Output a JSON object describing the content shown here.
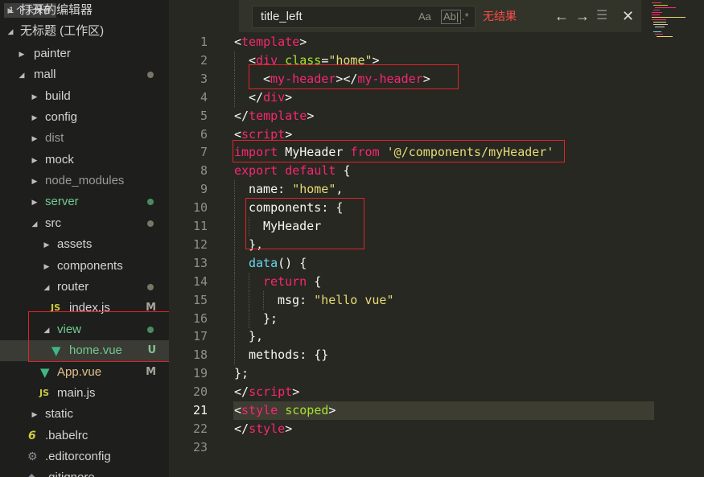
{
  "sidebar": {
    "open_editors_label": "打开的编辑器",
    "unsaved_badge": "1 个未保存",
    "workspace_label": "无标题 (工作区)",
    "items": [
      {
        "label": "painter"
      },
      {
        "label": "mall"
      },
      {
        "label": "build"
      },
      {
        "label": "config"
      },
      {
        "label": "dist"
      },
      {
        "label": "mock"
      },
      {
        "label": "node_modules"
      },
      {
        "label": "server"
      },
      {
        "label": "src"
      },
      {
        "label": "assets"
      },
      {
        "label": "components"
      },
      {
        "label": "router"
      },
      {
        "label": "index.js",
        "icon": "JS",
        "badge": "M"
      },
      {
        "label": "view"
      },
      {
        "label": "home.vue",
        "badge": "U"
      },
      {
        "label": "App.vue",
        "badge": "M"
      },
      {
        "label": "main.js",
        "icon": "JS"
      },
      {
        "label": "static"
      },
      {
        "label": ".babelrc"
      },
      {
        "label": ".editorconfig"
      },
      {
        "label": ".gitignore"
      }
    ]
  },
  "find": {
    "query": "title_left",
    "case_label": "Aa",
    "word_label": "Ab|",
    "regex_label": ".*",
    "status": "无结果",
    "prev_icon": "arrow-up-icon",
    "next_icon": "arrow-down-icon",
    "close_icon": "close-icon"
  },
  "editor": {
    "line_numbers": [
      "1",
      "2",
      "3",
      "4",
      "5",
      "6",
      "7",
      "8",
      "9",
      "10",
      "11",
      "12",
      "13",
      "14",
      "15",
      "16",
      "17",
      "18",
      "19",
      "20",
      "21",
      "22",
      "23"
    ],
    "current_line": 21,
    "lines": [
      [
        {
          "t": "<",
          "c": "p"
        },
        {
          "t": "template",
          "c": "tag"
        },
        {
          "t": ">",
          "c": "p"
        }
      ],
      [
        {
          "t": "<",
          "c": "p"
        },
        {
          "t": "div",
          "c": "tag"
        },
        {
          "t": " ",
          "c": "p"
        },
        {
          "t": "class",
          "c": "attr"
        },
        {
          "t": "=",
          "c": "p"
        },
        {
          "t": "\"home\"",
          "c": "str"
        },
        {
          "t": ">",
          "c": "p"
        }
      ],
      [
        {
          "t": "<",
          "c": "p"
        },
        {
          "t": "my-header",
          "c": "tag"
        },
        {
          "t": "></",
          "c": "p"
        },
        {
          "t": "my-header",
          "c": "tag"
        },
        {
          "t": ">",
          "c": "p"
        }
      ],
      [
        {
          "t": "</",
          "c": "p"
        },
        {
          "t": "div",
          "c": "tag"
        },
        {
          "t": ">",
          "c": "p"
        }
      ],
      [
        {
          "t": "</",
          "c": "p"
        },
        {
          "t": "template",
          "c": "tag"
        },
        {
          "t": ">",
          "c": "p"
        }
      ],
      [
        {
          "t": "<",
          "c": "p"
        },
        {
          "t": "script",
          "c": "tag"
        },
        {
          "t": ">",
          "c": "p"
        }
      ],
      [
        {
          "t": "import",
          "c": "kw"
        },
        {
          "t": " MyHeader ",
          "c": "p"
        },
        {
          "t": "from",
          "c": "kw"
        },
        {
          "t": " ",
          "c": "p"
        },
        {
          "t": "'@/components/myHeader'",
          "c": "str"
        }
      ],
      [
        {
          "t": "export",
          "c": "kw"
        },
        {
          "t": " ",
          "c": "p"
        },
        {
          "t": "default",
          "c": "kw"
        },
        {
          "t": " {",
          "c": "p"
        }
      ],
      [
        {
          "t": "name",
          "c": "p"
        },
        {
          "t": ": ",
          "c": "p"
        },
        {
          "t": "\"home\"",
          "c": "str"
        },
        {
          "t": ",",
          "c": "p"
        }
      ],
      [
        {
          "t": "components",
          "c": "p"
        },
        {
          "t": ": {",
          "c": "p"
        }
      ],
      [
        {
          "t": "MyHeader",
          "c": "p"
        }
      ],
      [
        {
          "t": "},",
          "c": "p"
        }
      ],
      [
        {
          "t": "data",
          "c": "fn"
        },
        {
          "t": "() {",
          "c": "p"
        }
      ],
      [
        {
          "t": "return",
          "c": "kw"
        },
        {
          "t": " {",
          "c": "p"
        }
      ],
      [
        {
          "t": "msg",
          "c": "p"
        },
        {
          "t": ": ",
          "c": "p"
        },
        {
          "t": "\"hello vue\"",
          "c": "str"
        }
      ],
      [
        {
          "t": "};",
          "c": "p"
        }
      ],
      [
        {
          "t": "},",
          "c": "p"
        }
      ],
      [
        {
          "t": "methods",
          "c": "p"
        },
        {
          "t": ": {}",
          "c": "p"
        }
      ],
      [
        {
          "t": "};",
          "c": "p"
        }
      ],
      [
        {
          "t": "</",
          "c": "p"
        },
        {
          "t": "script",
          "c": "tag"
        },
        {
          "t": ">",
          "c": "p"
        }
      ],
      [
        {
          "t": "<",
          "c": "p"
        },
        {
          "t": "style",
          "c": "tag"
        },
        {
          "t": " ",
          "c": "p"
        },
        {
          "t": "scoped",
          "c": "attr"
        },
        {
          "t": ">",
          "c": "p"
        }
      ],
      [
        {
          "t": "</",
          "c": "p"
        },
        {
          "t": "style",
          "c": "tag"
        },
        {
          "t": ">",
          "c": "p"
        }
      ],
      []
    ]
  },
  "colors": {
    "editor_bg": "#272822",
    "sidebar_bg": "#1e1f1c",
    "tag": "#f92672",
    "string": "#e6db74",
    "attribute": "#a6e22e",
    "function": "#66d9ef",
    "highlight_box": "#e0232a",
    "find_status": "#ff4a4a"
  }
}
